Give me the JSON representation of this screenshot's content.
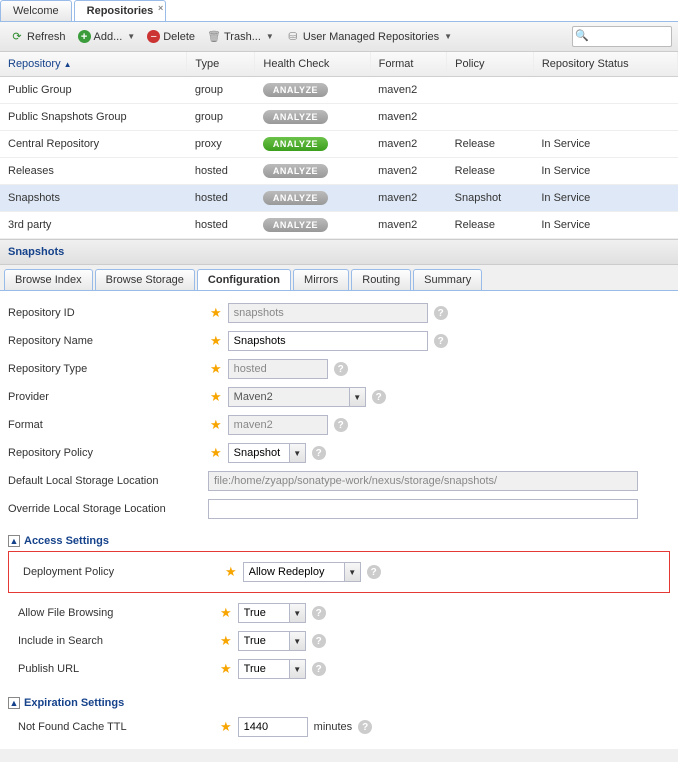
{
  "topTabs": {
    "welcome": "Welcome",
    "repositories": "Repositories"
  },
  "toolbar": {
    "refresh": "Refresh",
    "add": "Add...",
    "delete": "Delete",
    "trash": "Trash...",
    "userManaged": "User Managed Repositories",
    "searchPlaceholder": ""
  },
  "grid": {
    "headers": {
      "repository": "Repository",
      "type": "Type",
      "health": "Health Check",
      "format": "Format",
      "policy": "Policy",
      "status": "Repository Status"
    },
    "analyzeLabel": "ANALYZE",
    "rows": [
      {
        "name": "Public Group",
        "type": "group",
        "format": "maven2",
        "policy": "",
        "status": "",
        "green": false
      },
      {
        "name": "Public Snapshots Group",
        "type": "group",
        "format": "maven2",
        "policy": "",
        "status": "",
        "green": false
      },
      {
        "name": "Central Repository",
        "type": "proxy",
        "format": "maven2",
        "policy": "Release",
        "status": "In Service",
        "green": true
      },
      {
        "name": "Releases",
        "type": "hosted",
        "format": "maven2",
        "policy": "Release",
        "status": "In Service",
        "green": false
      },
      {
        "name": "Snapshots",
        "type": "hosted",
        "format": "maven2",
        "policy": "Snapshot",
        "status": "In Service",
        "green": false,
        "selected": true
      },
      {
        "name": "3rd party",
        "type": "hosted",
        "format": "maven2",
        "policy": "Release",
        "status": "In Service",
        "green": false
      }
    ]
  },
  "panel": {
    "title": "Snapshots"
  },
  "subtabs": {
    "browseIndex": "Browse Index",
    "browseStorage": "Browse Storage",
    "configuration": "Configuration",
    "mirrors": "Mirrors",
    "routing": "Routing",
    "summary": "Summary"
  },
  "form": {
    "repoId": {
      "label": "Repository ID",
      "value": "snapshots"
    },
    "repoName": {
      "label": "Repository Name",
      "value": "Snapshots"
    },
    "repoType": {
      "label": "Repository Type",
      "value": "hosted"
    },
    "provider": {
      "label": "Provider",
      "value": "Maven2"
    },
    "format": {
      "label": "Format",
      "value": "maven2"
    },
    "repoPolicy": {
      "label": "Repository Policy",
      "value": "Snapshot"
    },
    "defaultStorage": {
      "label": "Default Local Storage Location",
      "value": "file:/home/zyapp/sonatype-work/nexus/storage/snapshots/"
    },
    "overrideStorage": {
      "label": "Override Local Storage Location",
      "value": ""
    }
  },
  "access": {
    "legend": "Access Settings",
    "deployPolicy": {
      "label": "Deployment Policy",
      "value": "Allow Redeploy"
    },
    "allowBrowse": {
      "label": "Allow File Browsing",
      "value": "True"
    },
    "includeSearch": {
      "label": "Include in Search",
      "value": "True"
    },
    "publishUrl": {
      "label": "Publish URL",
      "value": "True"
    }
  },
  "expiration": {
    "legend": "Expiration Settings",
    "nfcTtl": {
      "label": "Not Found Cache TTL",
      "value": "1440",
      "unit": "minutes"
    }
  }
}
